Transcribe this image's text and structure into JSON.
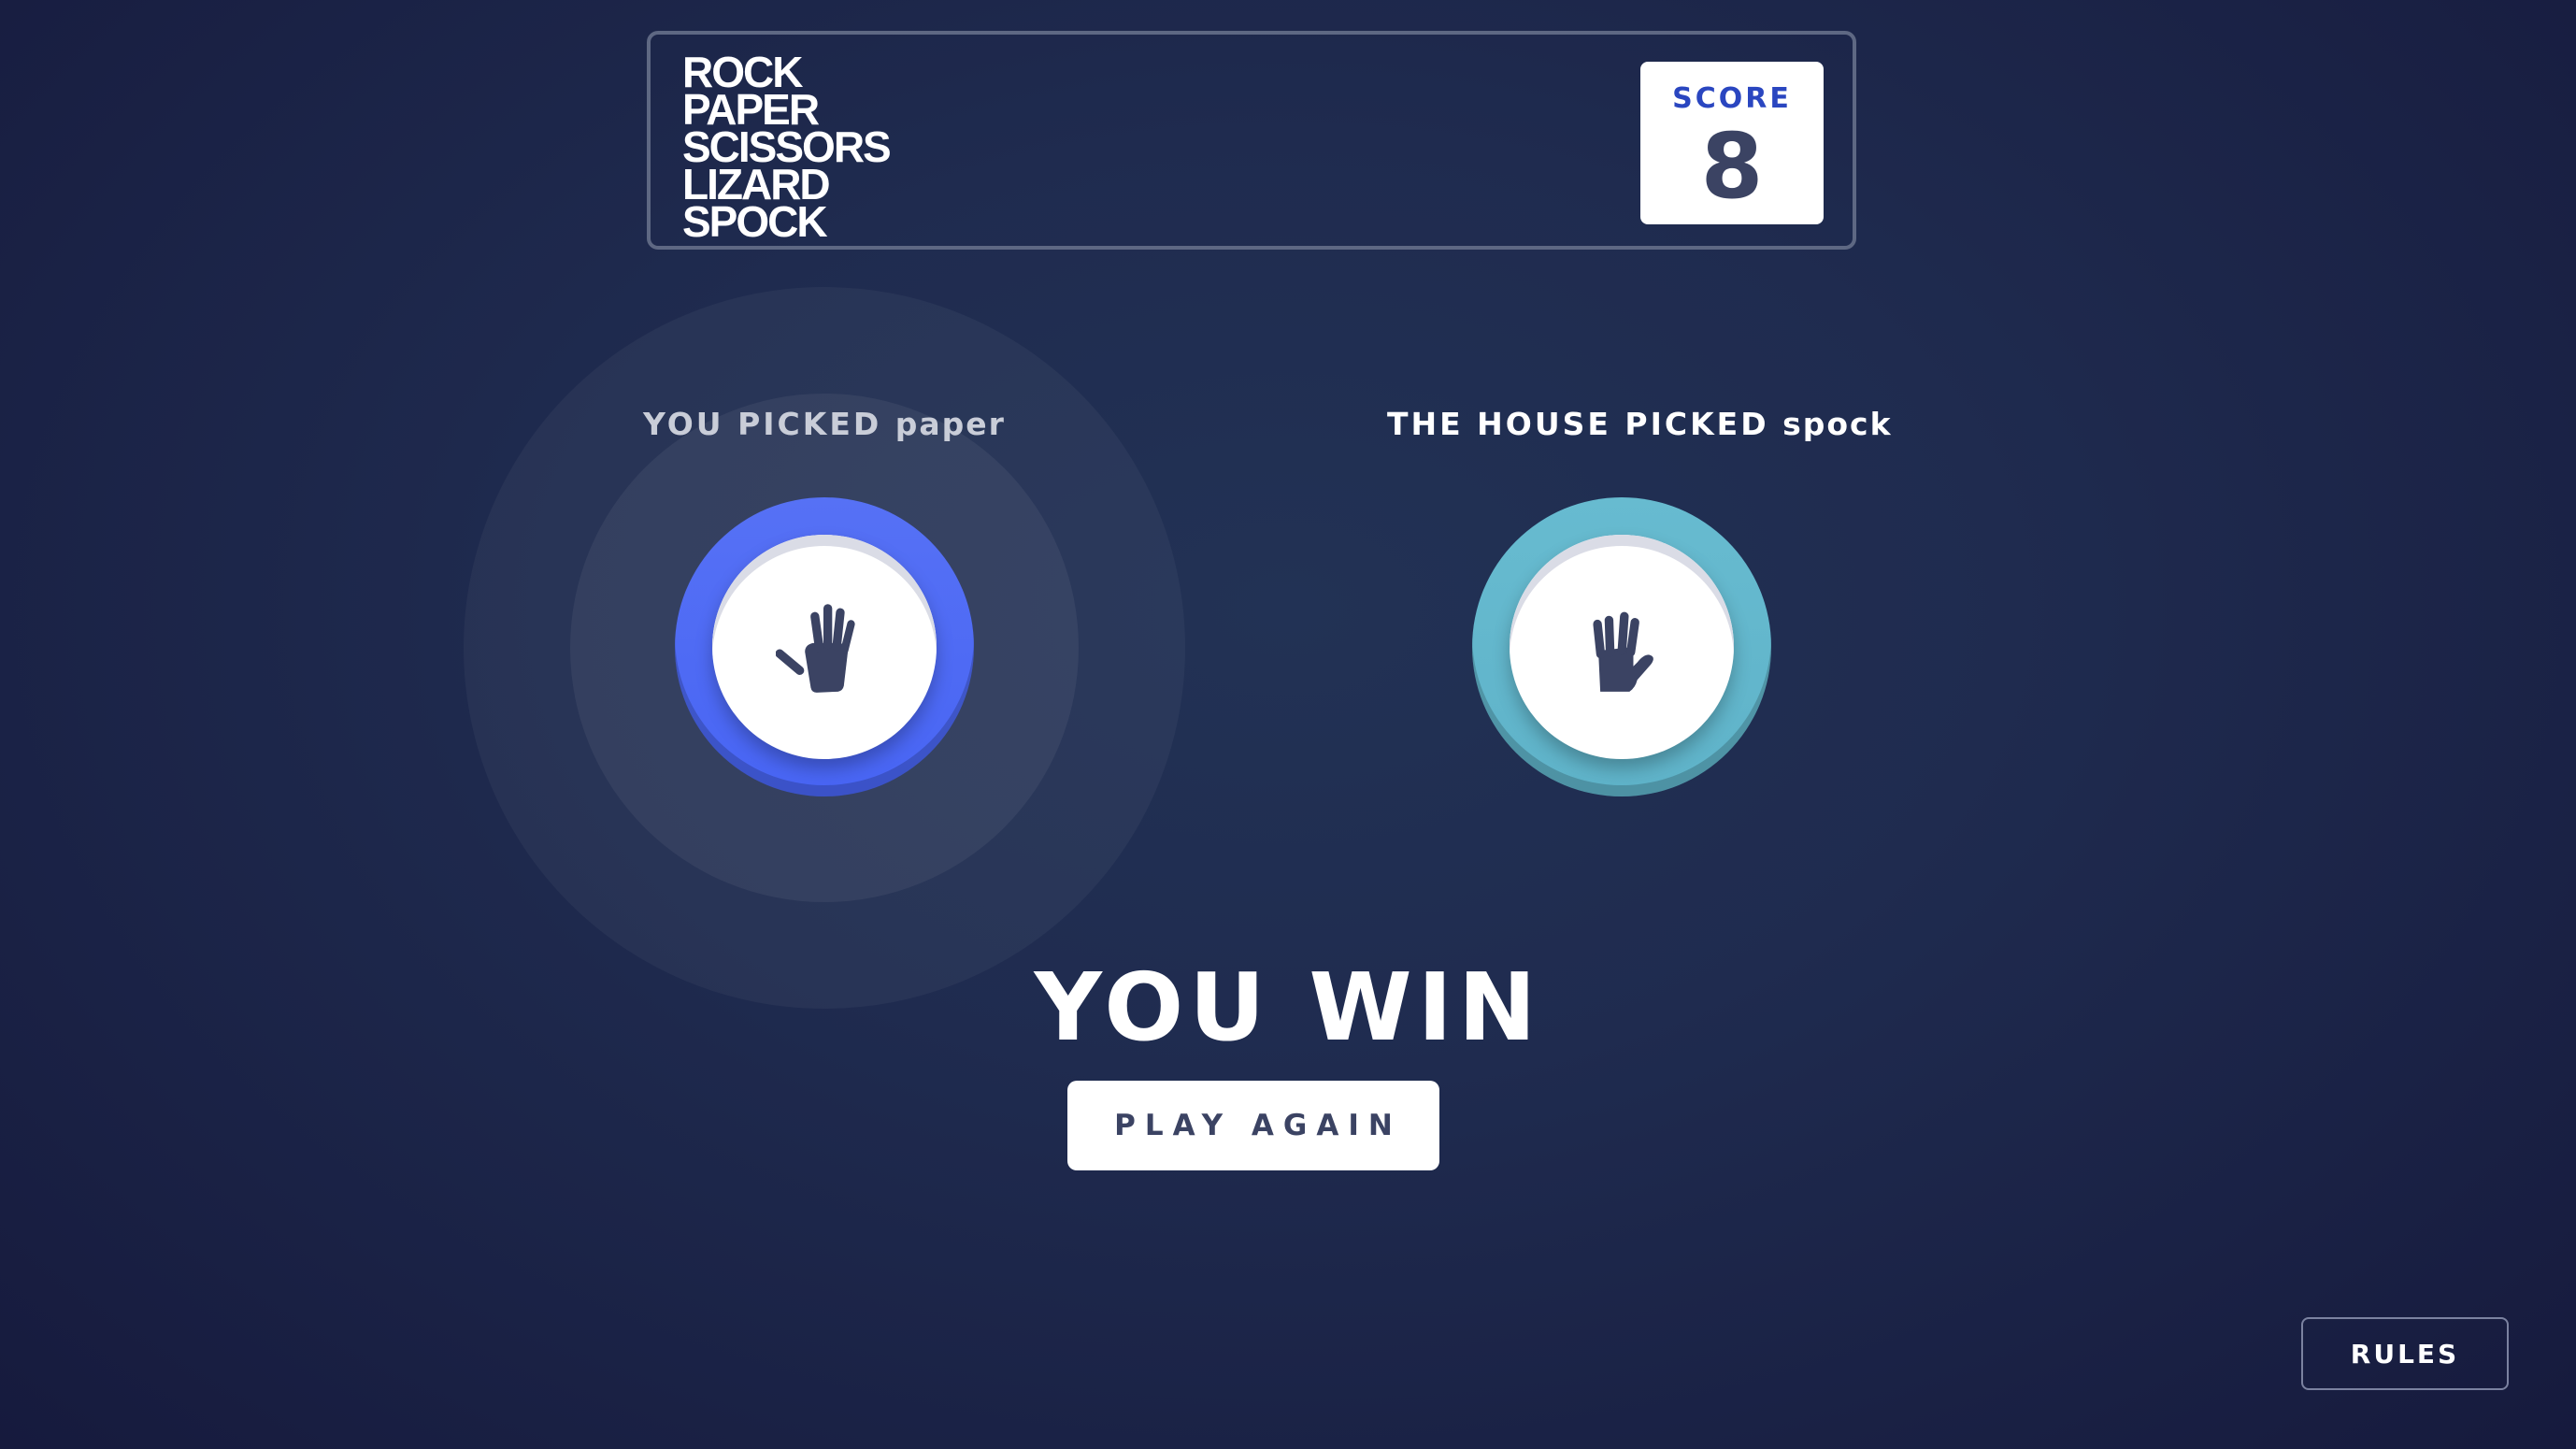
{
  "header": {
    "logo_lines": [
      "ROCK",
      "PAPER",
      "SCISSORS",
      "LIZARD",
      "SPOCK"
    ],
    "score_label": "SCORE",
    "score_value": "8"
  },
  "game": {
    "user_label_prefix": "YOU PICKED",
    "user_choice": "paper",
    "house_label_prefix": "THE HOUSE PICKED",
    "house_choice": "spock",
    "user_token_icon": "paper-hand-icon",
    "house_token_icon": "spock-hand-icon",
    "user_token_color": "#4865f4",
    "house_token_color": "#5fb3c9",
    "result_text": "YOU WIN",
    "play_again_label": "PLAY AGAIN"
  },
  "footer": {
    "rules_label": "RULES"
  }
}
